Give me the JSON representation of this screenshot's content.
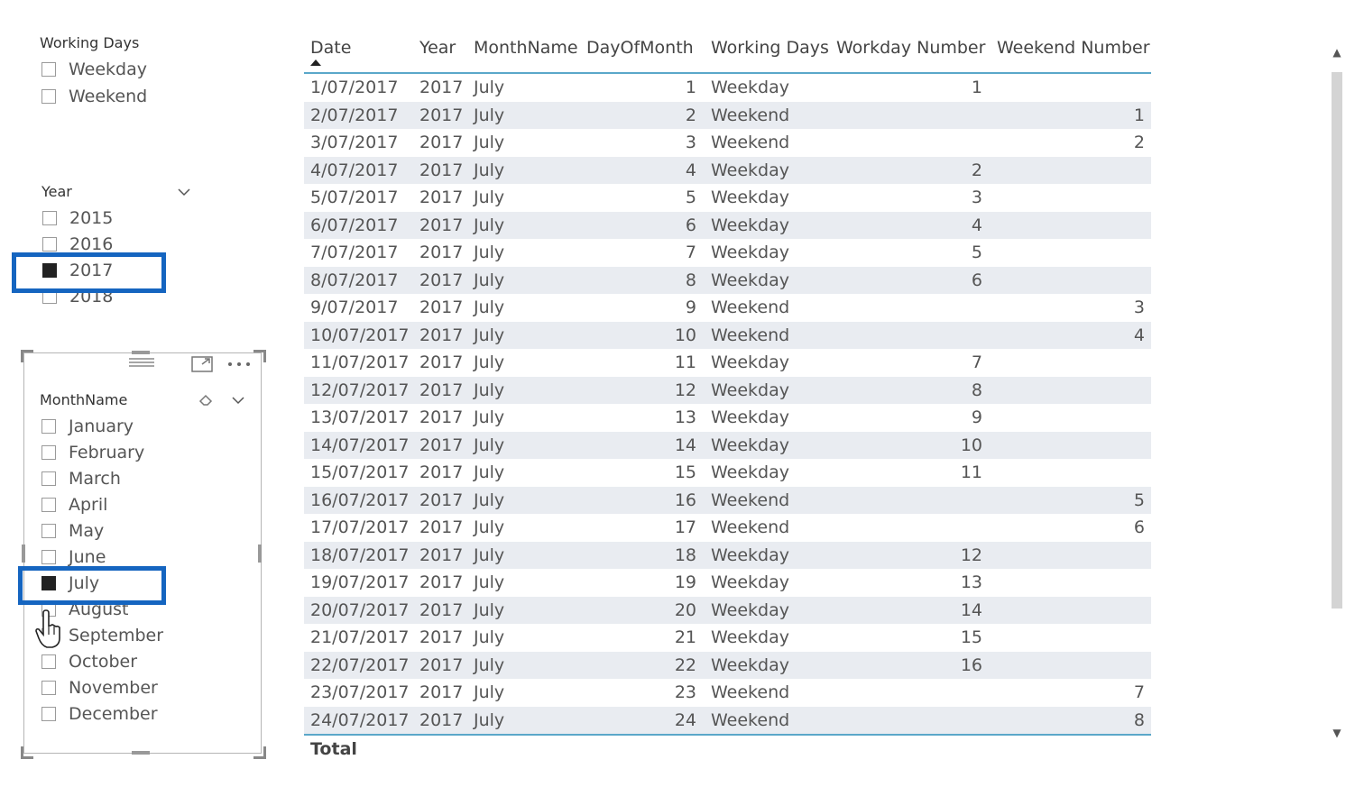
{
  "slicers": {
    "working_days": {
      "header": "Working Days",
      "items": [
        {
          "label": "Weekday",
          "checked": false
        },
        {
          "label": "Weekend",
          "checked": false
        }
      ]
    },
    "year": {
      "header": "Year",
      "items": [
        {
          "label": "2015",
          "checked": false
        },
        {
          "label": "2016",
          "checked": false
        },
        {
          "label": "2017",
          "checked": true
        },
        {
          "label": "2018",
          "checked": false
        }
      ]
    },
    "month": {
      "header": "MonthName",
      "items": [
        {
          "label": "January",
          "checked": false
        },
        {
          "label": "February",
          "checked": false
        },
        {
          "label": "March",
          "checked": false
        },
        {
          "label": "April",
          "checked": false
        },
        {
          "label": "May",
          "checked": false
        },
        {
          "label": "June",
          "checked": false
        },
        {
          "label": "July",
          "checked": true
        },
        {
          "label": "August",
          "checked": false
        },
        {
          "label": "September",
          "checked": false
        },
        {
          "label": "October",
          "checked": false
        },
        {
          "label": "November",
          "checked": false
        },
        {
          "label": "December",
          "checked": false
        }
      ]
    }
  },
  "table": {
    "columns": [
      "Date",
      "Year",
      "MonthName",
      "DayOfMonth",
      "Working Days",
      "Workday Number",
      "Weekend Number"
    ],
    "rows": [
      [
        "1/07/2017",
        "2017",
        "July",
        "1",
        "Weekday",
        "1",
        ""
      ],
      [
        "2/07/2017",
        "2017",
        "July",
        "2",
        "Weekend",
        "",
        "1"
      ],
      [
        "3/07/2017",
        "2017",
        "July",
        "3",
        "Weekend",
        "",
        "2"
      ],
      [
        "4/07/2017",
        "2017",
        "July",
        "4",
        "Weekday",
        "2",
        ""
      ],
      [
        "5/07/2017",
        "2017",
        "July",
        "5",
        "Weekday",
        "3",
        ""
      ],
      [
        "6/07/2017",
        "2017",
        "July",
        "6",
        "Weekday",
        "4",
        ""
      ],
      [
        "7/07/2017",
        "2017",
        "July",
        "7",
        "Weekday",
        "5",
        ""
      ],
      [
        "8/07/2017",
        "2017",
        "July",
        "8",
        "Weekday",
        "6",
        ""
      ],
      [
        "9/07/2017",
        "2017",
        "July",
        "9",
        "Weekend",
        "",
        "3"
      ],
      [
        "10/07/2017",
        "2017",
        "July",
        "10",
        "Weekend",
        "",
        "4"
      ],
      [
        "11/07/2017",
        "2017",
        "July",
        "11",
        "Weekday",
        "7",
        ""
      ],
      [
        "12/07/2017",
        "2017",
        "July",
        "12",
        "Weekday",
        "8",
        ""
      ],
      [
        "13/07/2017",
        "2017",
        "July",
        "13",
        "Weekday",
        "9",
        ""
      ],
      [
        "14/07/2017",
        "2017",
        "July",
        "14",
        "Weekday",
        "10",
        ""
      ],
      [
        "15/07/2017",
        "2017",
        "July",
        "15",
        "Weekday",
        "11",
        ""
      ],
      [
        "16/07/2017",
        "2017",
        "July",
        "16",
        "Weekend",
        "",
        "5"
      ],
      [
        "17/07/2017",
        "2017",
        "July",
        "17",
        "Weekend",
        "",
        "6"
      ],
      [
        "18/07/2017",
        "2017",
        "July",
        "18",
        "Weekday",
        "12",
        ""
      ],
      [
        "19/07/2017",
        "2017",
        "July",
        "19",
        "Weekday",
        "13",
        ""
      ],
      [
        "20/07/2017",
        "2017",
        "July",
        "20",
        "Weekday",
        "14",
        ""
      ],
      [
        "21/07/2017",
        "2017",
        "July",
        "21",
        "Weekday",
        "15",
        ""
      ],
      [
        "22/07/2017",
        "2017",
        "July",
        "22",
        "Weekday",
        "16",
        ""
      ],
      [
        "23/07/2017",
        "2017",
        "July",
        "23",
        "Weekend",
        "",
        "7"
      ],
      [
        "24/07/2017",
        "2017",
        "July",
        "24",
        "Weekend",
        "",
        "8"
      ]
    ],
    "total_label": "Total"
  },
  "colors": {
    "highlight": "#1565c0",
    "header_rule": "#5aa7c9",
    "alt_row": "#e9ecf1"
  },
  "icons": [
    "chevron-down-icon",
    "eraser-icon",
    "focus-mode-icon",
    "more-options-icon",
    "drag-handle-icon",
    "hand-cursor-icon",
    "scroll-up-icon",
    "scroll-down-icon"
  ]
}
